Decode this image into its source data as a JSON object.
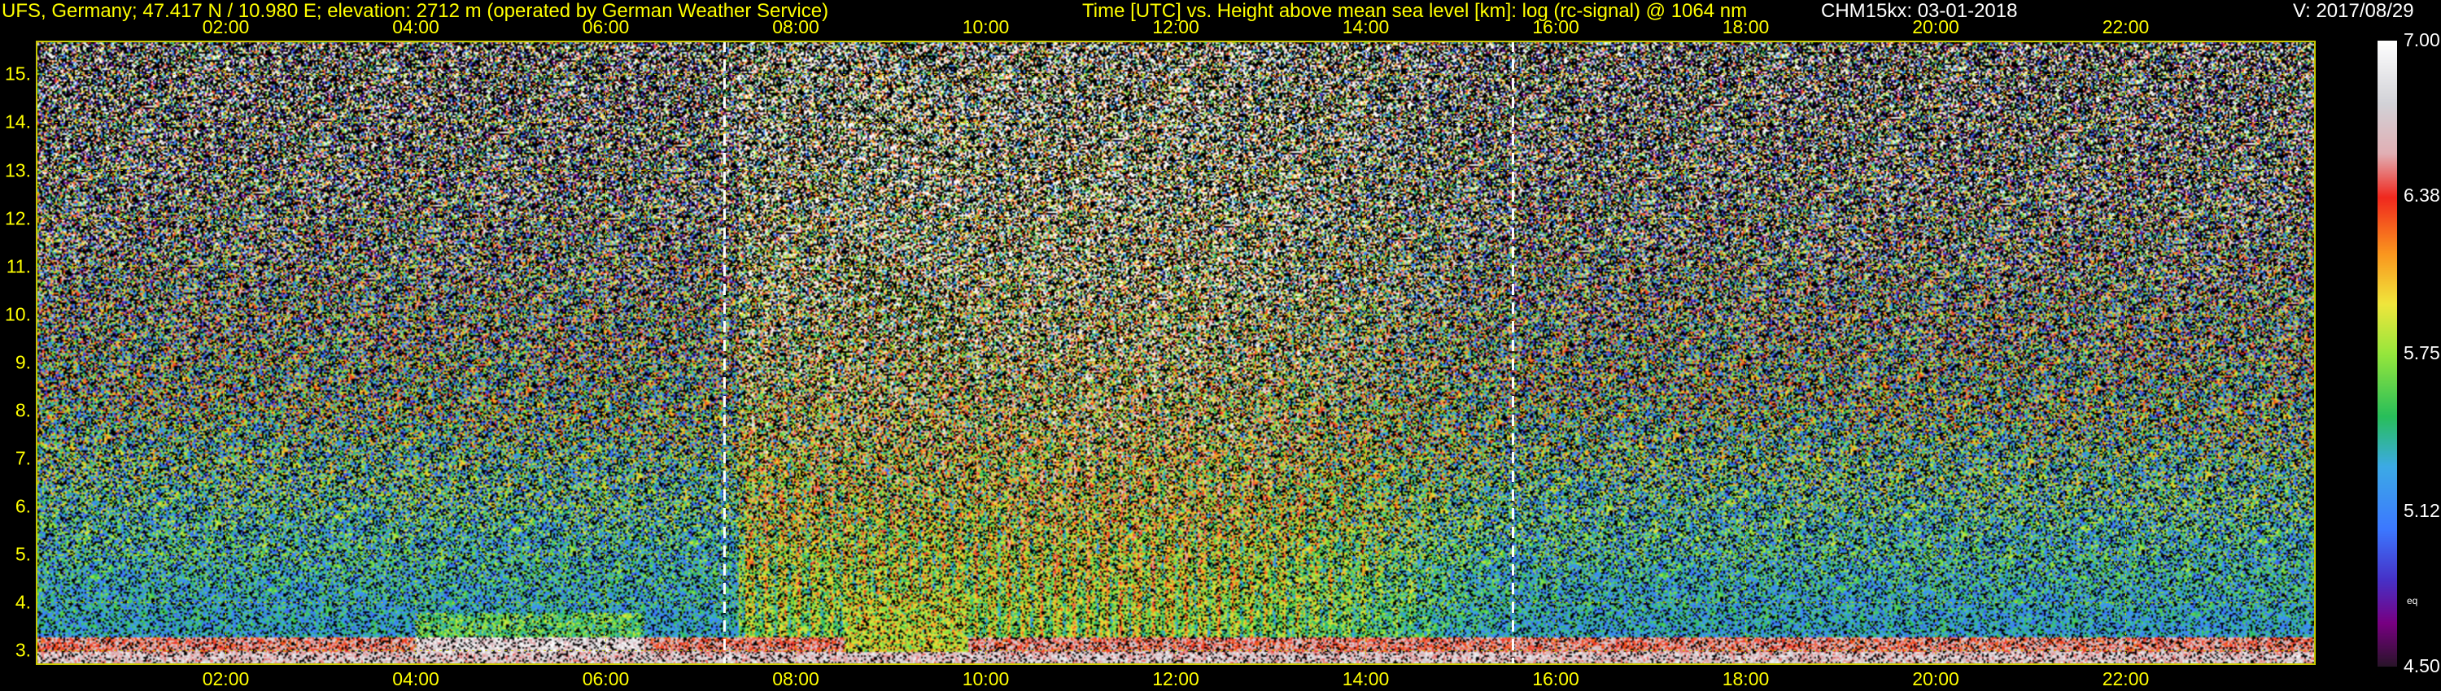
{
  "header": {
    "station": "UFS, Germany; 47.417 N / 10.980 E; elevation: 2712 m  (operated by German Weather Service)",
    "axes_desc": "Time [UTC] vs. Height above mean sea level [km]: log (rc-signal) @ 1064 nm",
    "instrument_date": "CHM15kx: 03-01-2018",
    "version": "V: 2017/08/29"
  },
  "colors": {
    "axis_text": "#ffff00",
    "grid": "#c8c800",
    "marker": "#ffffff",
    "background": "#000000"
  },
  "chart_data": {
    "type": "heatmap",
    "x_ticks": [
      "02:00",
      "04:00",
      "06:00",
      "08:00",
      "10:00",
      "12:00",
      "14:00",
      "16:00",
      "18:00",
      "20:00",
      "22:00"
    ],
    "x_tick_hours": [
      2,
      4,
      6,
      8,
      10,
      12,
      14,
      16,
      18,
      20,
      22
    ],
    "xlim_hours": [
      0,
      24
    ],
    "y_ticks": [
      "3.",
      "4.",
      "5.",
      "6.",
      "7.",
      "8.",
      "9.",
      "10.",
      "11.",
      "12.",
      "13.",
      "14.",
      "15."
    ],
    "y_tick_values": [
      3,
      4,
      5,
      6,
      7,
      8,
      9,
      10,
      11,
      12,
      13,
      14,
      15
    ],
    "ylim_km": [
      2.7,
      15.7
    ],
    "vertical_markers_hours": [
      7.25,
      15.55
    ],
    "colorbar": {
      "labels": [
        "7.00",
        "6.38",
        "5.75",
        "5.12",
        "4.50"
      ],
      "values": [
        7.0,
        6.38,
        5.75,
        5.12,
        4.5
      ],
      "extra_label": "eq"
    },
    "grid": true
  }
}
